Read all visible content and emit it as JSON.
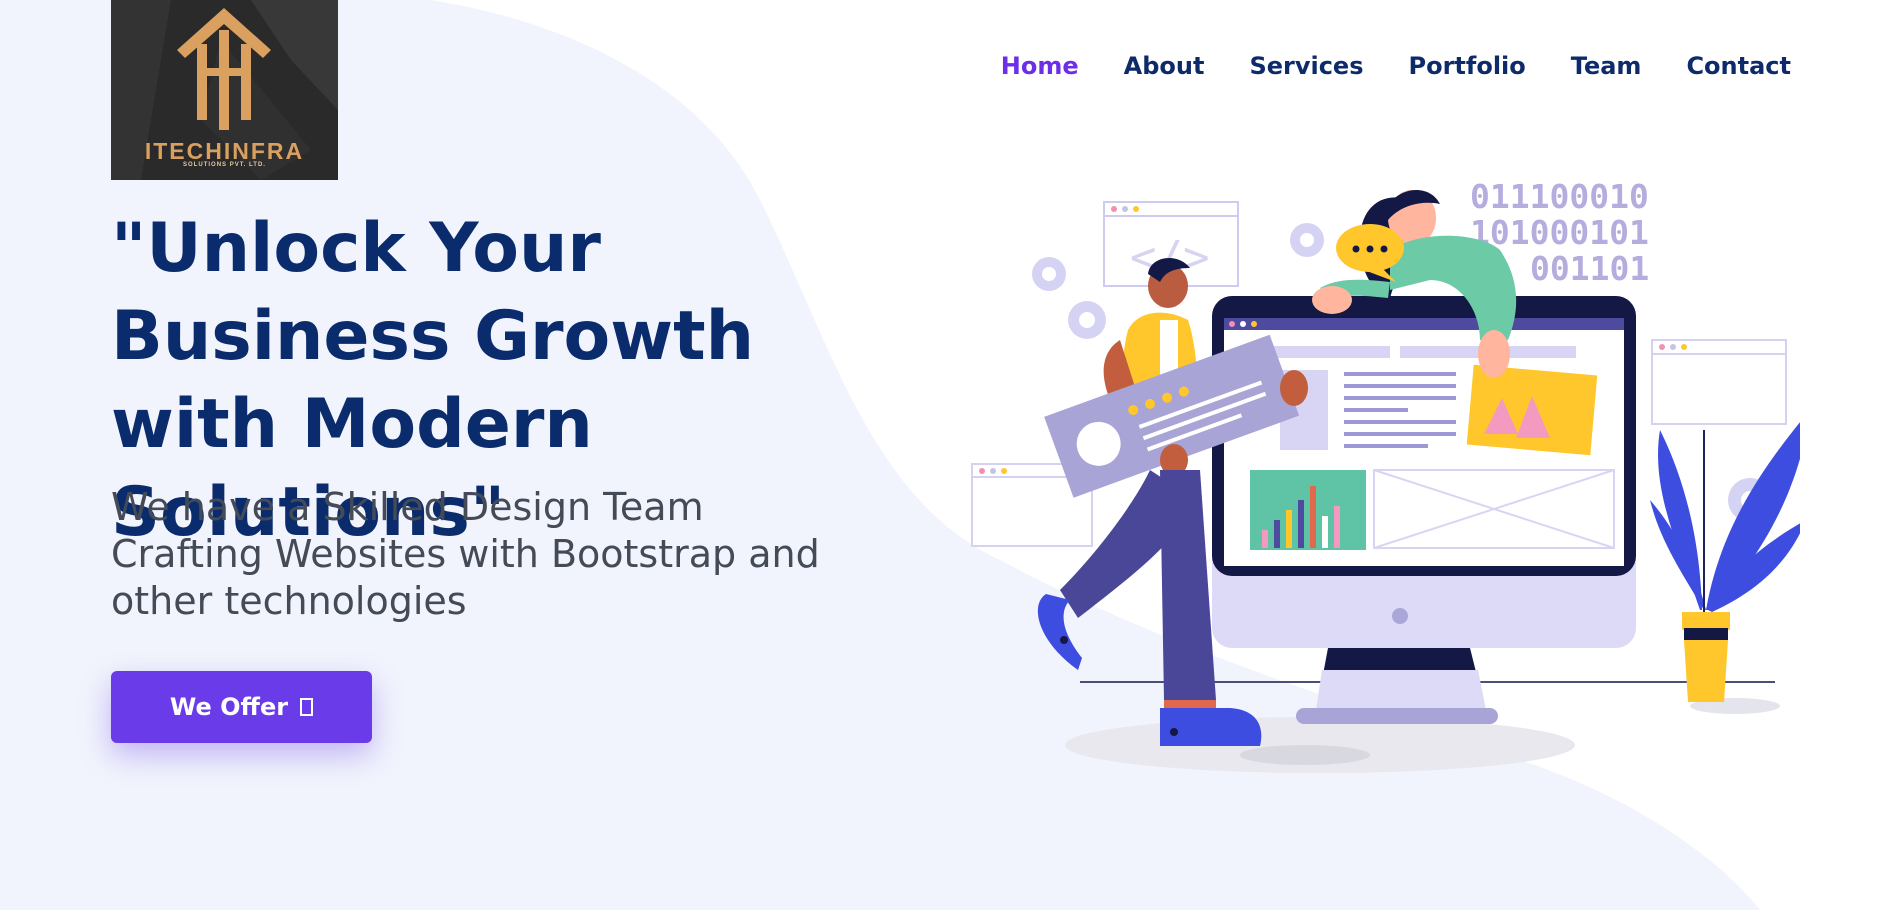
{
  "brand": {
    "name": "ITECHINFRA",
    "tagline": "SOLUTIONS PVT. LTD."
  },
  "nav": {
    "items": [
      {
        "label": "Home",
        "active": true
      },
      {
        "label": "About",
        "active": false
      },
      {
        "label": "Services",
        "active": false
      },
      {
        "label": "Portfolio",
        "active": false
      },
      {
        "label": "Team",
        "active": false
      },
      {
        "label": "Contact",
        "active": false
      }
    ]
  },
  "hero": {
    "title": "\"Unlock Your Business Growth with Modern Solutions\"",
    "subtitle": "We have a Skilled Design Team Crafting Websites with Bootstrap and other technologies",
    "cta_label": "We Offer"
  },
  "illustration": {
    "binary_lines": [
      "011100010",
      "101000101",
      "001101"
    ]
  },
  "colors": {
    "primary": "#6a3be8",
    "heading": "#0a2b6c",
    "nav": "#0d2b6b",
    "nav_active": "#6c2ee8",
    "background_wave": "#f1f4fc"
  }
}
